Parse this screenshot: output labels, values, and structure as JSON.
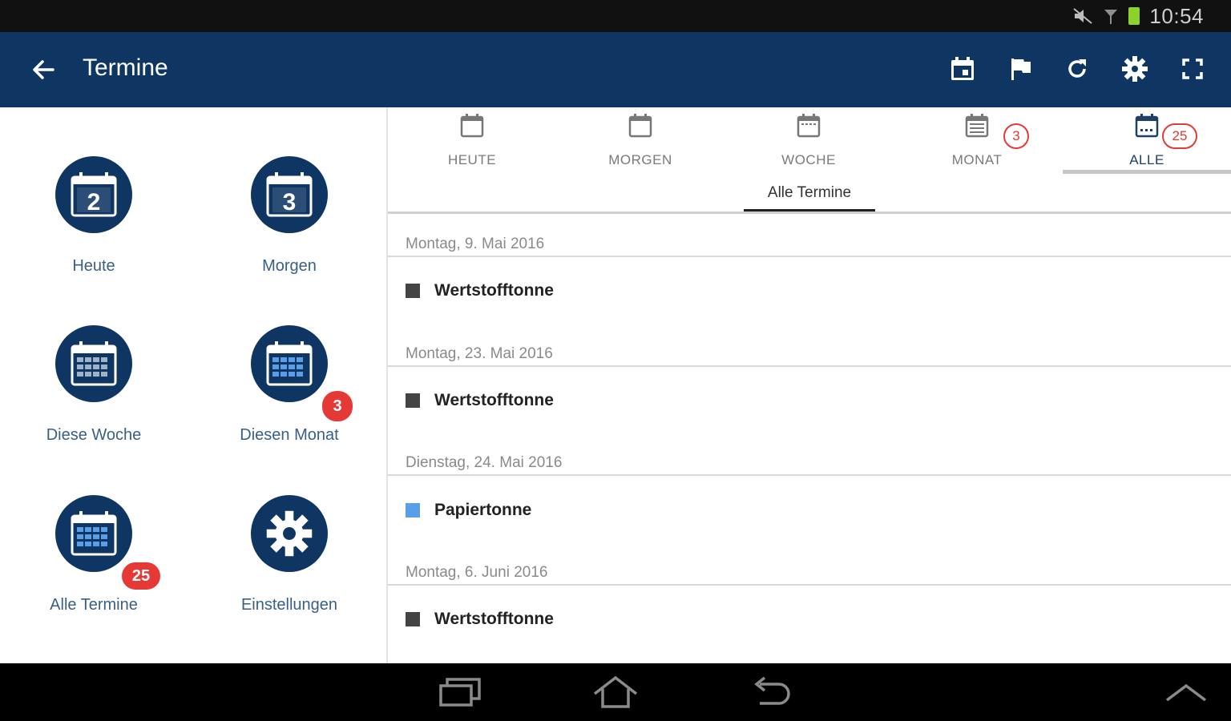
{
  "status": {
    "time": "10:54"
  },
  "appbar": {
    "title": "Termine"
  },
  "tiles": [
    {
      "label": "Heute",
      "day": "2"
    },
    {
      "label": "Morgen",
      "day": "3"
    },
    {
      "label": "Diese Woche"
    },
    {
      "label": "Diesen Monat",
      "badge": "3"
    },
    {
      "label": "Alle Termine",
      "badge": "25"
    },
    {
      "label": "Einstellungen"
    }
  ],
  "tabs": [
    {
      "label": "HEUTE"
    },
    {
      "label": "MORGEN"
    },
    {
      "label": "WOCHE"
    },
    {
      "label": "MONAT",
      "badge": "3"
    },
    {
      "label": "ALLE",
      "badge": "25"
    }
  ],
  "subtab": {
    "label": "Alle Termine"
  },
  "events": [
    {
      "date": "Montag, 9. Mai 2016",
      "name": "Wertstofftonne",
      "color": "#444444"
    },
    {
      "date": "Montag, 23. Mai 2016",
      "name": "Wertstofftonne",
      "color": "#444444"
    },
    {
      "date": "Dienstag, 24. Mai 2016",
      "name": "Papiertonne",
      "color": "#5b9ee8"
    },
    {
      "date": "Montag, 6. Juni 2016",
      "name": "Wertstofftonne",
      "color": "#444444"
    }
  ],
  "colors": {
    "primary": "#0f3663",
    "badge": "#e53935"
  }
}
